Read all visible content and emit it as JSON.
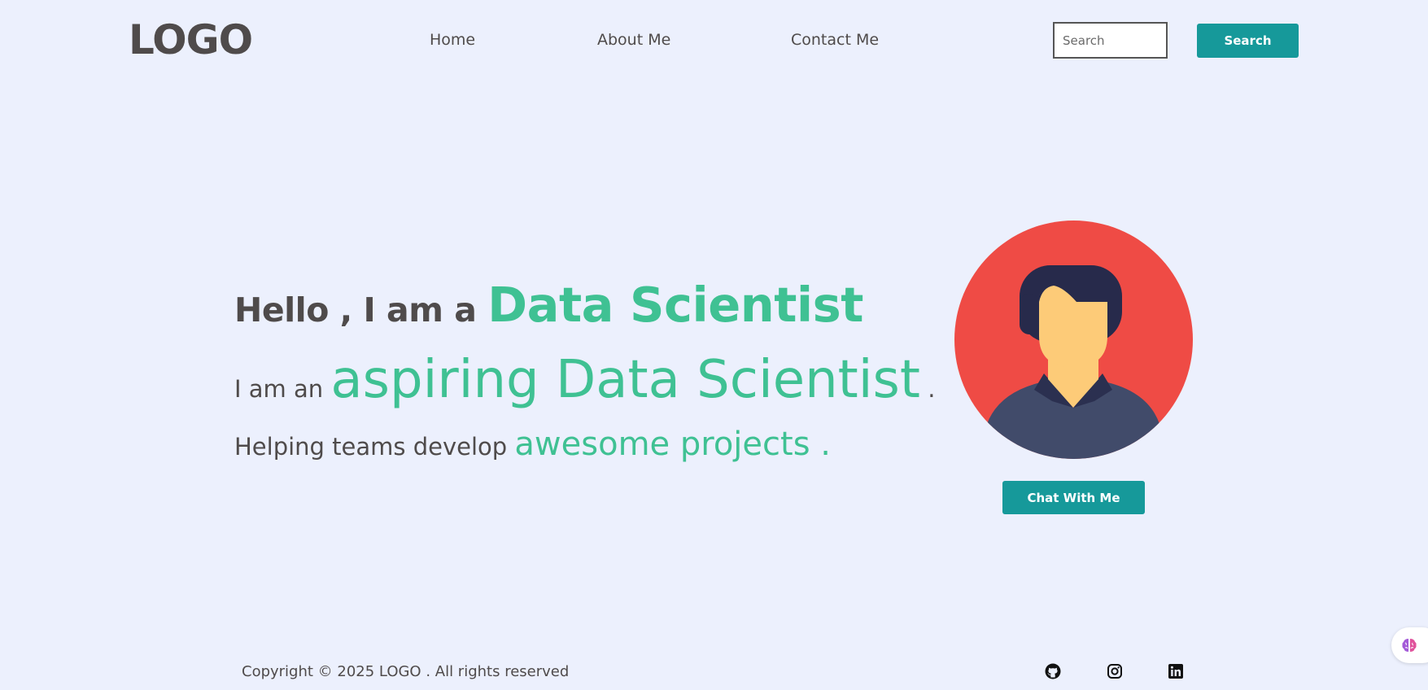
{
  "header": {
    "logo": "LOGO",
    "nav": {
      "home": "Home",
      "about": "About Me",
      "contact": "Contact Me"
    },
    "search": {
      "placeholder": "Search",
      "button_label": "Search"
    }
  },
  "hero": {
    "line1_prefix": "Hello , I am a ",
    "line1_highlight": "Data Scientist",
    "line2_prefix": "I am an ",
    "line2_highlight": "aspiring Data Scientist",
    "line2_suffix": " .",
    "line3_prefix": "Helping teams develop ",
    "line3_highlight": "awesome projects ."
  },
  "avatar": {
    "icon": "user-avatar-icon"
  },
  "chat_button": "Chat With Me",
  "footer": {
    "copyright": "Copyright © 2025 LOGO . All rights reserved",
    "social_icons": [
      "github-icon",
      "instagram-icon",
      "linkedin-icon"
    ]
  },
  "colors": {
    "background": "#ecf0fd",
    "accent_button": "#16999a",
    "highlight_text": "#3fc193",
    "body_text": "#4f4b4b",
    "avatar_circle": "#ef4b45",
    "avatar_hair": "#272a4b",
    "avatar_skin": "#fdcb78",
    "avatar_shirt": "#414b6a"
  }
}
